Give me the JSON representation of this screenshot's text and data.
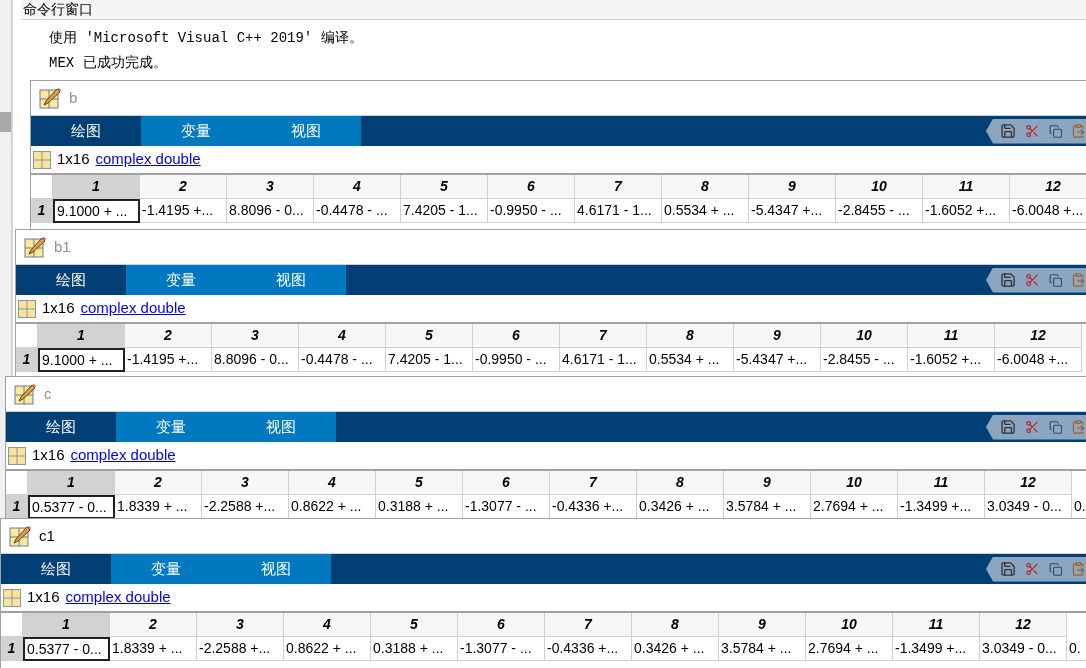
{
  "command_window": {
    "title": "命令行窗口",
    "lines": [
      "使用 'Microsoft Visual C++ 2019' 编译。",
      "MEX 已成功完成。"
    ]
  },
  "editors": [
    {
      "title": "b",
      "active": false,
      "tabs": [
        {
          "label": "绘图",
          "highlighted": false
        },
        {
          "label": "变量",
          "highlighted": true
        },
        {
          "label": "视图",
          "highlighted": true
        }
      ],
      "size": "1x16",
      "class_link": "complex double",
      "columns": [
        "1",
        "2",
        "3",
        "4",
        "5",
        "6",
        "7",
        "8",
        "9",
        "10",
        "11",
        "12"
      ],
      "row_header": "1",
      "cells": [
        {
          "value": "9.1000 + ...",
          "selected": true
        },
        {
          "value": "-1.4195 +...",
          "selected": false
        },
        {
          "value": "8.8096 - 0...",
          "selected": false
        },
        {
          "value": "-0.4478 - ...",
          "selected": false
        },
        {
          "value": "7.4205 - 1...",
          "selected": false
        },
        {
          "value": "-0.9950 - ...",
          "selected": false
        },
        {
          "value": "4.6171 - 1...",
          "selected": false
        },
        {
          "value": "0.5534 + ...",
          "selected": false
        },
        {
          "value": "-5.4347 +...",
          "selected": false
        },
        {
          "value": "-2.8455 - ...",
          "selected": false
        },
        {
          "value": "-1.6052 +...",
          "selected": false
        },
        {
          "value": "-6.0048 +...",
          "selected": false
        }
      ]
    },
    {
      "title": "b1",
      "active": false,
      "tabs": [
        {
          "label": "绘图",
          "highlighted": false
        },
        {
          "label": "变量",
          "highlighted": true
        },
        {
          "label": "视图",
          "highlighted": true
        }
      ],
      "size": "1x16",
      "class_link": "complex double",
      "columns": [
        "1",
        "2",
        "3",
        "4",
        "5",
        "6",
        "7",
        "8",
        "9",
        "10",
        "11",
        "12"
      ],
      "row_header": "1",
      "cells": [
        {
          "value": "9.1000 + ...",
          "selected": true
        },
        {
          "value": "-1.4195 +...",
          "selected": false
        },
        {
          "value": "8.8096 - 0...",
          "selected": false
        },
        {
          "value": "-0.4478 - ...",
          "selected": false
        },
        {
          "value": "7.4205 - 1...",
          "selected": false
        },
        {
          "value": "-0.9950 - ...",
          "selected": false
        },
        {
          "value": "4.6171 - 1...",
          "selected": false
        },
        {
          "value": "0.5534 + ...",
          "selected": false
        },
        {
          "value": "-5.4347 +...",
          "selected": false
        },
        {
          "value": "-2.8455 - ...",
          "selected": false
        },
        {
          "value": "-1.6052 +...",
          "selected": false
        },
        {
          "value": "-6.0048 +...",
          "selected": false
        }
      ]
    },
    {
      "title": "c",
      "active": false,
      "tabs": [
        {
          "label": "绘图",
          "highlighted": false
        },
        {
          "label": "变量",
          "highlighted": true
        },
        {
          "label": "视图",
          "highlighted": true
        }
      ],
      "size": "1x16",
      "class_link": "complex double",
      "columns": [
        "1",
        "2",
        "3",
        "4",
        "5",
        "6",
        "7",
        "8",
        "9",
        "10",
        "11",
        "12"
      ],
      "row_header": "1",
      "cells": [
        {
          "value": "0.5377 - 0...",
          "selected": true
        },
        {
          "value": "1.8339 + ...",
          "selected": false
        },
        {
          "value": "-2.2588 +...",
          "selected": false
        },
        {
          "value": "0.8622 + ...",
          "selected": false
        },
        {
          "value": "0.3188 + ...",
          "selected": false
        },
        {
          "value": "-1.3077 - ...",
          "selected": false
        },
        {
          "value": "-0.4336 +...",
          "selected": false
        },
        {
          "value": "0.3426 + ...",
          "selected": false
        },
        {
          "value": "3.5784 + ...",
          "selected": false
        },
        {
          "value": "2.7694 + ...",
          "selected": false
        },
        {
          "value": "-1.3499 +...",
          "selected": false
        },
        {
          "value": "3.0349 - 0...",
          "selected": false
        },
        {
          "value": "0.",
          "selected": false
        }
      ]
    },
    {
      "title": "c1",
      "active": true,
      "tabs": [
        {
          "label": "绘图",
          "highlighted": false
        },
        {
          "label": "变量",
          "highlighted": true
        },
        {
          "label": "视图",
          "highlighted": true
        }
      ],
      "size": "1x16",
      "class_link": "complex double",
      "columns": [
        "1",
        "2",
        "3",
        "4",
        "5",
        "6",
        "7",
        "8",
        "9",
        "10",
        "11",
        "12"
      ],
      "row_header": "1",
      "cells": [
        {
          "value": "0.5377 - 0...",
          "selected": true
        },
        {
          "value": "1.8339 + ...",
          "selected": false
        },
        {
          "value": "-2.2588 +...",
          "selected": false
        },
        {
          "value": "0.8622 + ...",
          "selected": false
        },
        {
          "value": "0.3188 + ...",
          "selected": false
        },
        {
          "value": "-1.3077 - ...",
          "selected": false
        },
        {
          "value": "-0.4336 +...",
          "selected": false
        },
        {
          "value": "0.3426 + ...",
          "selected": false
        },
        {
          "value": "3.5784 + ...",
          "selected": false
        },
        {
          "value": "2.7694 + ...",
          "selected": false
        },
        {
          "value": "-1.3499 +...",
          "selected": false
        },
        {
          "value": "3.0349 - 0...",
          "selected": false
        },
        {
          "value": "0.",
          "selected": false
        }
      ]
    }
  ]
}
